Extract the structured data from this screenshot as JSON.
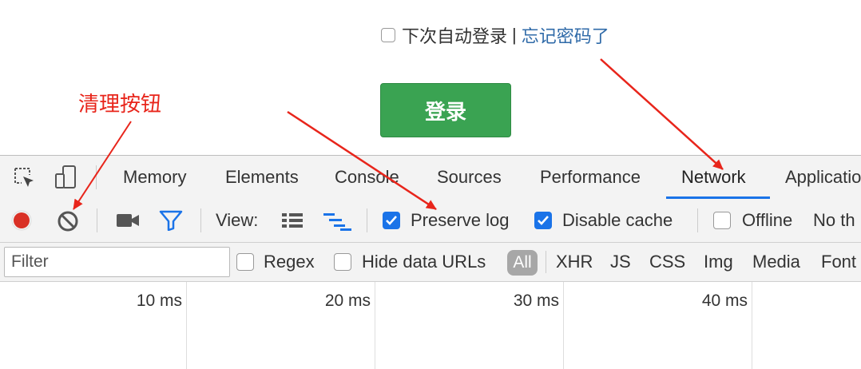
{
  "login": {
    "remember_label": "下次自动登录",
    "separator": "|",
    "forgot_label": "忘记密码了",
    "submit_label": "登录",
    "submit_color": "#3aa352"
  },
  "annotation": {
    "label": "清理按钮",
    "color": "#e8251b"
  },
  "devtools": {
    "tabs": [
      {
        "label": "Memory"
      },
      {
        "label": "Elements"
      },
      {
        "label": "Console"
      },
      {
        "label": "Sources"
      },
      {
        "label": "Performance"
      },
      {
        "label": "Network",
        "active": true
      },
      {
        "label": "Applicatio"
      }
    ],
    "toolbar": {
      "view_label": "View:",
      "preserve_log_label": "Preserve log",
      "preserve_log_checked": true,
      "disable_cache_label": "Disable cache",
      "disable_cache_checked": true,
      "offline_label": "Offline",
      "offline_checked": false,
      "throttle_label": "No th"
    },
    "filterbar": {
      "filter_placeholder": "Filter",
      "regex_label": "Regex",
      "hide_data_urls_label": "Hide data URLs",
      "types": [
        "All",
        "XHR",
        "JS",
        "CSS",
        "Img",
        "Media",
        "Font"
      ]
    },
    "timeline": {
      "ticks": [
        "10 ms",
        "20 ms",
        "30 ms",
        "40 ms"
      ]
    },
    "accent_color": "#1a73e8",
    "record_color": "#d93025"
  }
}
